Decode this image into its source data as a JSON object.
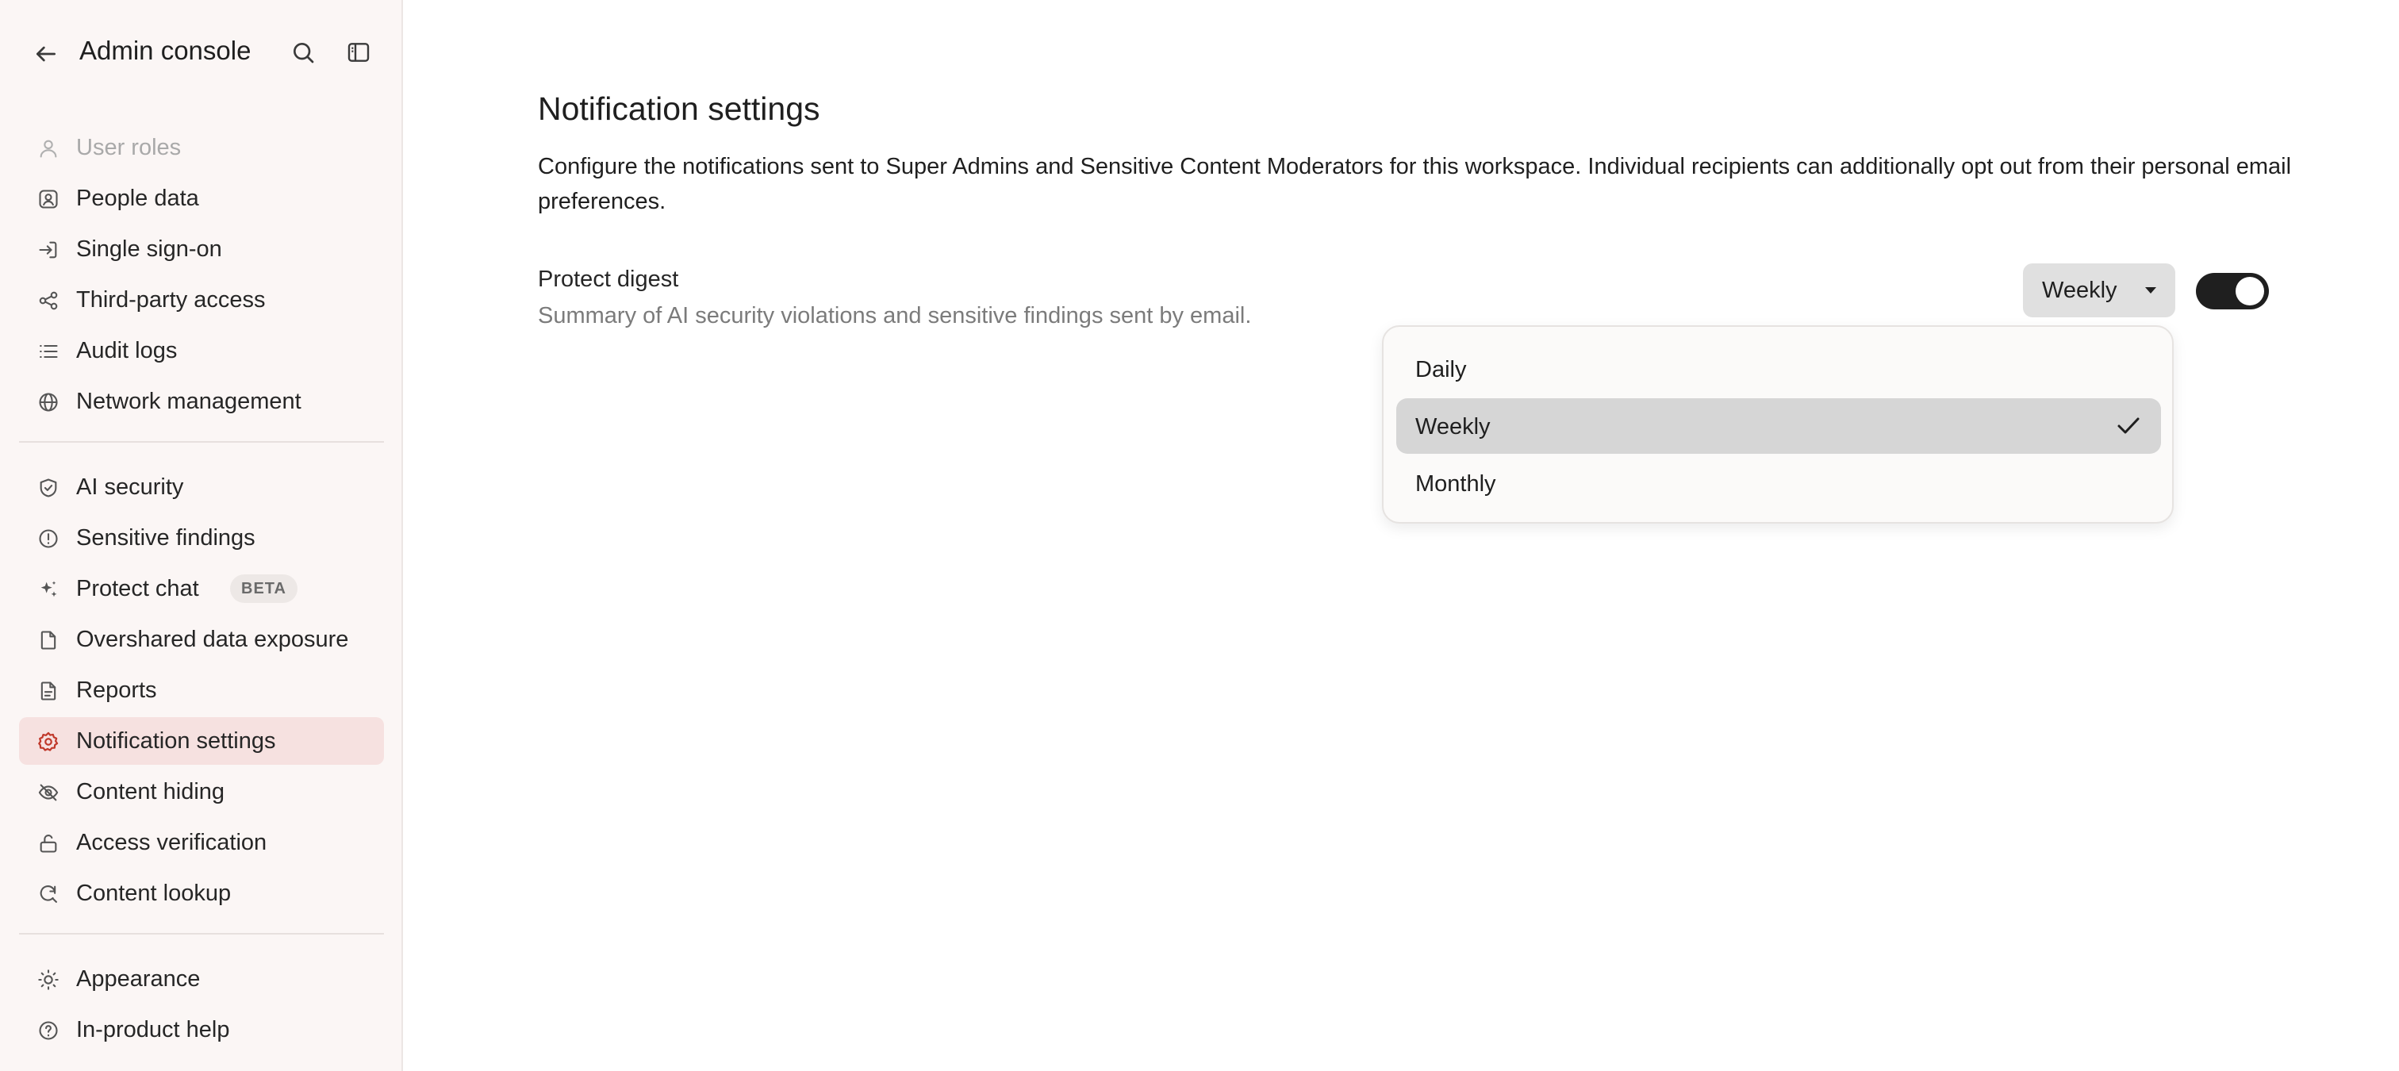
{
  "sidebar": {
    "title": "Admin console",
    "items": [
      {
        "label": "User roles",
        "icon": "user-icon",
        "state": "disabled"
      },
      {
        "label": "People data",
        "icon": "person-card-icon",
        "state": "normal"
      },
      {
        "label": "Single sign-on",
        "icon": "sign-in-icon",
        "state": "normal"
      },
      {
        "label": "Third-party access",
        "icon": "share-nodes-icon",
        "state": "normal"
      },
      {
        "label": "Audit logs",
        "icon": "list-icon",
        "state": "normal"
      },
      {
        "label": "Network management",
        "icon": "globe-icon",
        "state": "normal"
      },
      {
        "label": "AI security",
        "icon": "shield-check-icon",
        "state": "normal"
      },
      {
        "label": "Sensitive findings",
        "icon": "alert-circle-icon",
        "state": "normal"
      },
      {
        "label": "Protect chat",
        "icon": "sparkle-icon",
        "state": "normal",
        "badge": "BETA"
      },
      {
        "label": "Overshared data exposure",
        "icon": "file-icon",
        "state": "normal"
      },
      {
        "label": "Reports",
        "icon": "report-icon",
        "state": "normal"
      },
      {
        "label": "Notification settings",
        "icon": "gear-icon",
        "state": "active"
      },
      {
        "label": "Content hiding",
        "icon": "eye-off-icon",
        "state": "normal"
      },
      {
        "label": "Access verification",
        "icon": "unlock-icon",
        "state": "normal"
      },
      {
        "label": "Content lookup",
        "icon": "refresh-search-icon",
        "state": "normal"
      },
      {
        "label": "Appearance",
        "icon": "sun-icon",
        "state": "normal"
      },
      {
        "label": "In-product help",
        "icon": "help-circle-icon",
        "state": "normal"
      }
    ]
  },
  "main": {
    "title": "Notification settings",
    "description": "Configure the notifications sent to Super Admins and Sensitive Content Moderators for this workspace. Individual recipients can additionally opt out from their personal email preferences.",
    "setting": {
      "title": "Protect digest",
      "subtitle": "Summary of AI security violations and sensitive findings sent by email.",
      "frequency": "Weekly",
      "enabled": true
    },
    "dropdown": {
      "options": [
        "Daily",
        "Weekly",
        "Monthly"
      ],
      "selected": "Weekly"
    }
  },
  "colors": {
    "sidebar_bg": "#fbf6f5",
    "active_item_bg": "#f6e1e0",
    "active_icon": "#c0392b",
    "toggle_on": "#1f1f1f"
  }
}
